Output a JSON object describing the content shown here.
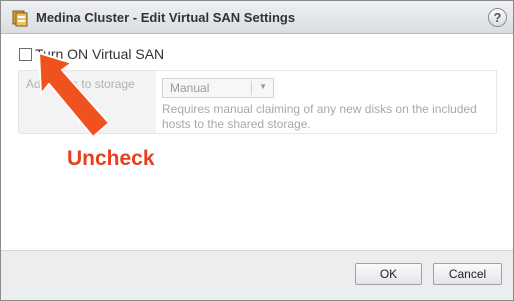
{
  "dialog": {
    "title": "Medina Cluster - Edit Virtual SAN Settings",
    "help_icon": "?"
  },
  "vsan": {
    "checkbox_label": "Turn ON Virtual SAN",
    "checked": false,
    "setting_label": "Add disks to storage",
    "mode_value": "Manual",
    "mode_description": "Requires manual claiming of any new disks on the included hosts to the shared storage."
  },
  "annotation": {
    "text": "Uncheck",
    "color": "#e8401c"
  },
  "footer": {
    "ok_label": "OK",
    "cancel_label": "Cancel"
  }
}
